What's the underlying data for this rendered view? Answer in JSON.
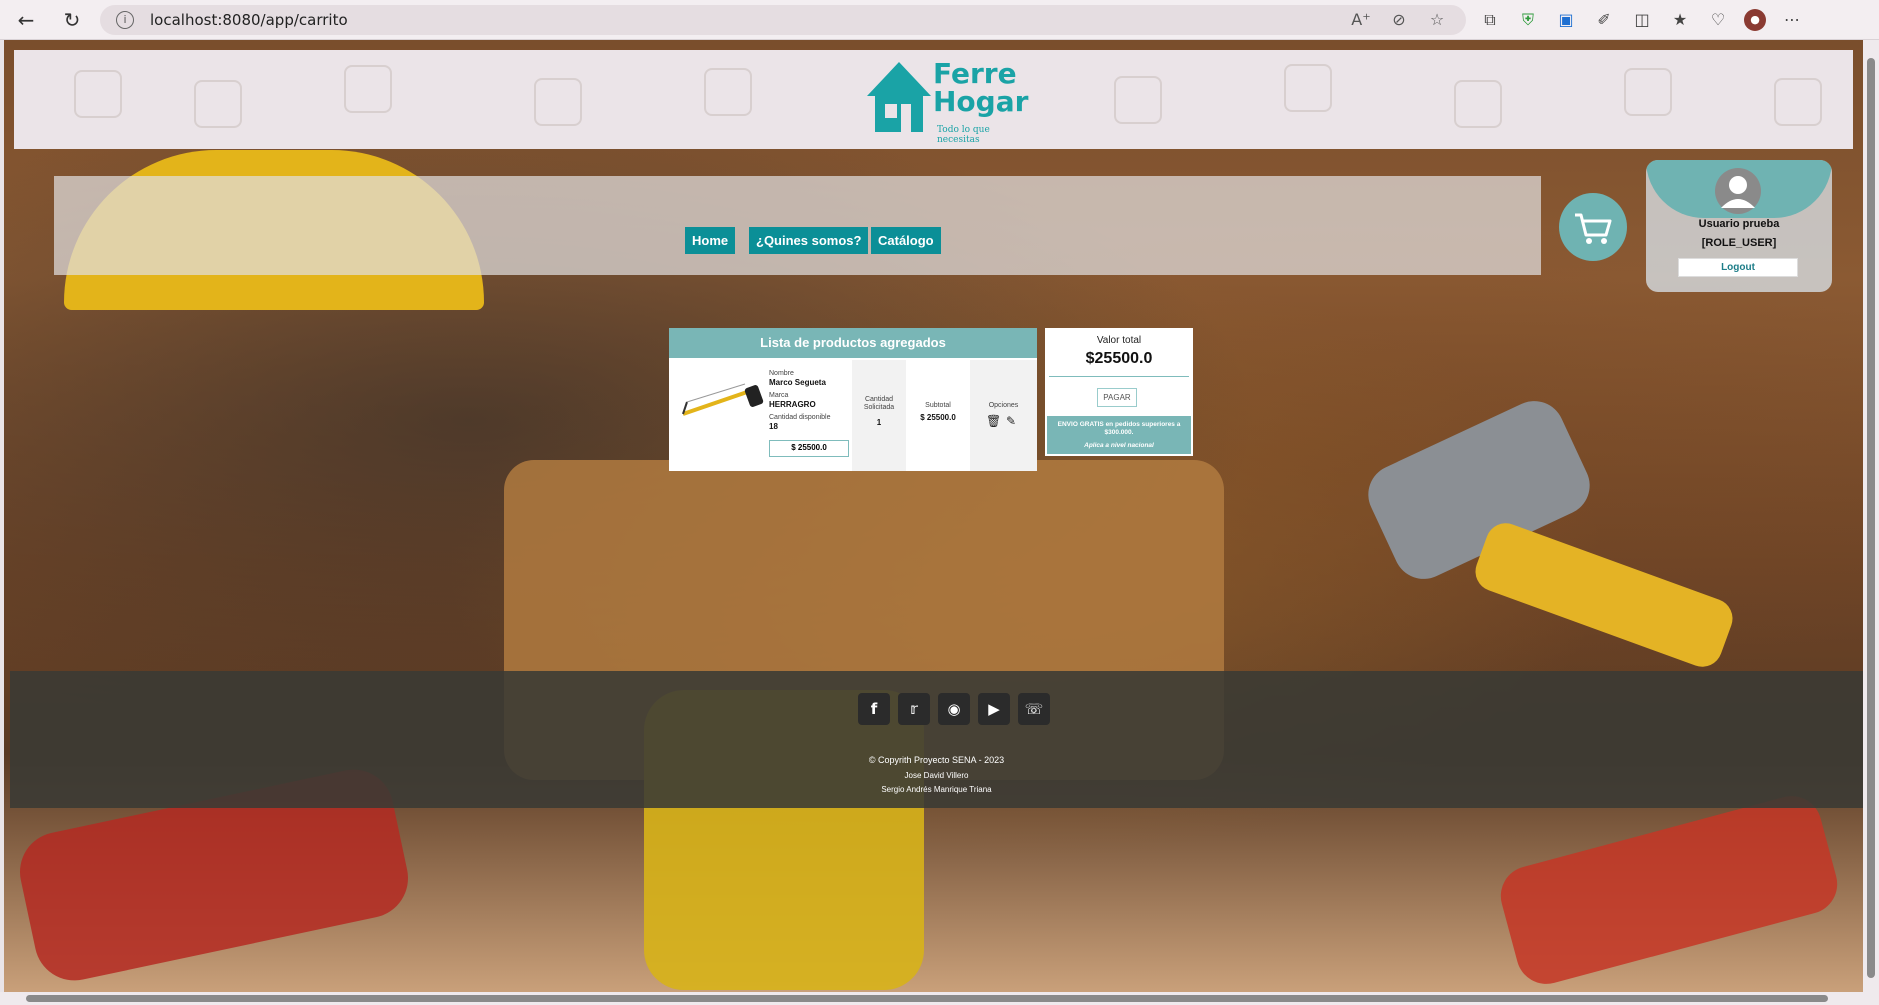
{
  "browser": {
    "back_icon": "arrow-left-icon",
    "reload_icon": "reload-icon",
    "url": "localhost:8080/app/carrito",
    "url_icons": [
      "read-aloud-icon",
      "zoom-out-icon",
      "favorite-star-icon"
    ],
    "extension_icons": [
      "collections-icon",
      "shield-extension-icon",
      "screen-capture-icon",
      "extensions-icon",
      "split-screen-icon",
      "favorites-icon",
      "performance-icon",
      "profile-avatar-icon",
      "more-menu-icon"
    ]
  },
  "brand": {
    "name": "Ferre Hogar",
    "tagline": "Todo lo que necesitas",
    "color": "#1aa3a6"
  },
  "nav": {
    "items": [
      {
        "label": "Home"
      },
      {
        "label": "¿Quines somos?"
      },
      {
        "label": "Catálogo"
      }
    ],
    "color": "#0b8f97"
  },
  "cart_button_icon": "shopping-cart-icon",
  "user": {
    "name": "Usuario prueba",
    "role": "[ROLE_USER]",
    "logout_label": "Logout"
  },
  "cart": {
    "title": "Lista de productos agregados",
    "item": {
      "name_label": "Nombre",
      "name": "Marco Segueta",
      "brand_label": "Marca",
      "brand": "HERRAGRO",
      "available_label": "Cantidad disponible",
      "available": "18",
      "price": "$ 25500.0",
      "qty_header": "Cantidad Solicitada",
      "qty": "1",
      "subtotal_header": "Subtotal",
      "subtotal": "$ 25500.0",
      "options_header": "Opciones"
    }
  },
  "summary": {
    "total_label": "Valor total",
    "total": "$25500.0",
    "pay_label": "PAGAR",
    "shipping_note": "ENVIO GRATIS en pedidos superiores a $300.000.",
    "shipping_sub": "Aplica a nivel nacional"
  },
  "footer": {
    "social": [
      "facebook-icon",
      "twitter-icon",
      "instagram-icon",
      "youtube-icon",
      "whatsapp-icon"
    ],
    "copyright": "© Copyrith Proyecto SENA - 2023",
    "authors": [
      "Jose David Villero",
      "Sergio Andrés Manrique Triana"
    ]
  }
}
